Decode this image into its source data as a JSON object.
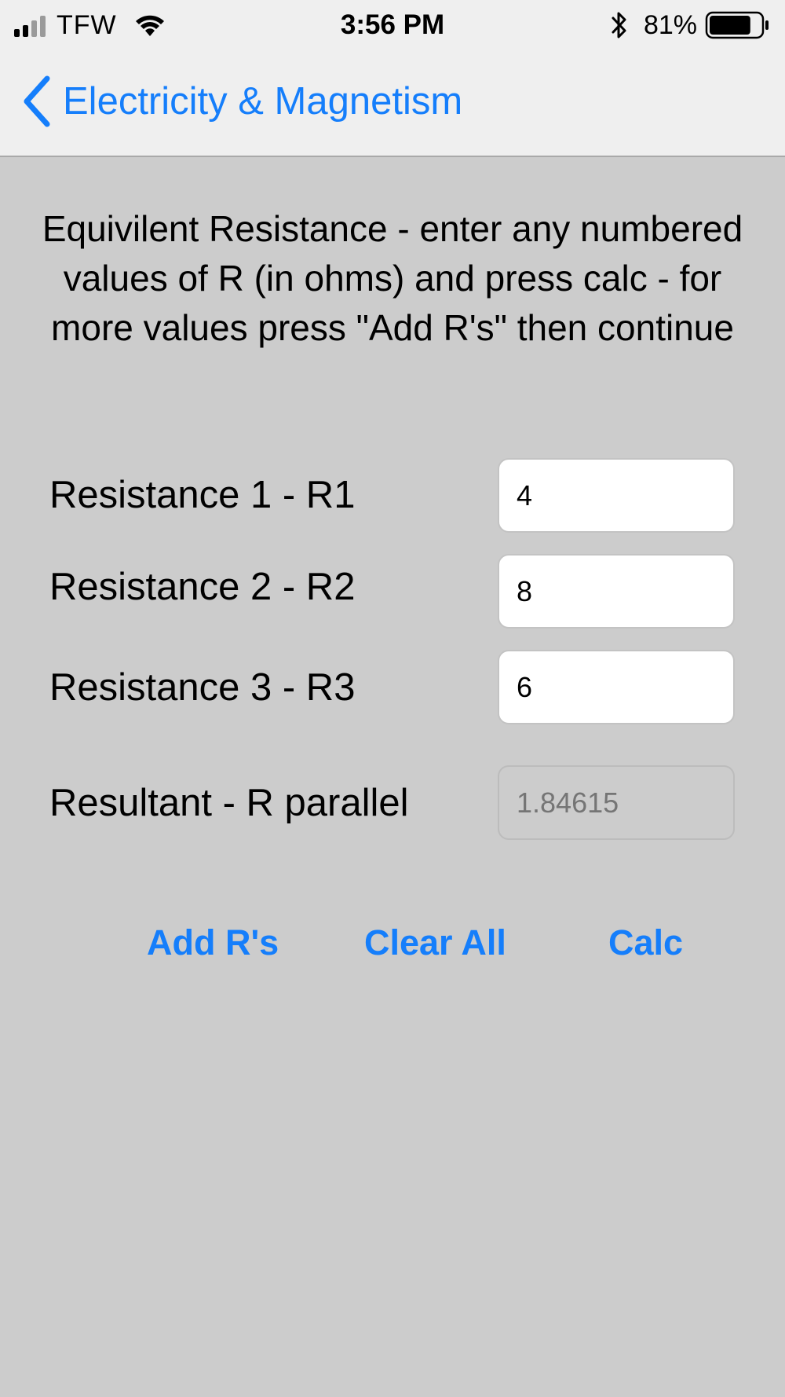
{
  "status_bar": {
    "carrier": "TFW",
    "time": "3:56 PM",
    "battery_percent": "81%",
    "battery_level": 0.81,
    "signal_strength_bars": 2,
    "icons": [
      "signal-bars-icon",
      "wifi-icon",
      "bluetooth-icon",
      "battery-icon"
    ]
  },
  "nav": {
    "back_label": "Electricity & Magnetism",
    "back_icon": "chevron-left-icon"
  },
  "main": {
    "instructions": "Equivilent Resistance - enter any numbered values of R (in ohms) and press calc - for more values press \"Add R's\" then continue",
    "rows": [
      {
        "label": "Resistance 1 - R1",
        "value": "4"
      },
      {
        "label": "Resistance 2 - R2",
        "value": "8"
      },
      {
        "label": "Resistance 3 - R3",
        "value": "6"
      }
    ],
    "result": {
      "label": "Resultant - R parallel",
      "placeholder": "1.84615"
    }
  },
  "buttons": {
    "add_label": "Add R's",
    "clear_label": "Clear All",
    "calc_label": "Calc"
  },
  "colors": {
    "accent": "#157efb",
    "background": "#cccccc",
    "bar_background": "#efefef"
  }
}
